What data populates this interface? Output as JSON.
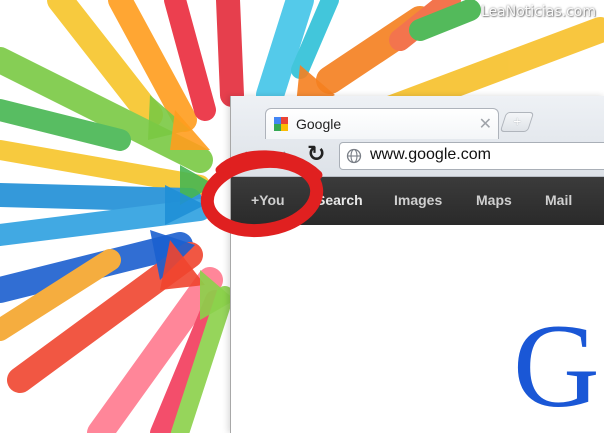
{
  "watermark": "LeaNoticias.com",
  "browser": {
    "tab": {
      "title": "Google",
      "favicon": "google-favicon-icon",
      "close_glyph": "✕"
    },
    "new_tab_glyph": "+",
    "nav": {
      "back_glyph": "←",
      "forward_glyph": "→",
      "reload_glyph": "↻"
    },
    "address": {
      "url": "www.google.com",
      "icon": "globe-icon"
    }
  },
  "google_bar": {
    "items": [
      "+You",
      "Search",
      "Images",
      "Maps",
      "Mail"
    ],
    "active": "Search"
  },
  "logo_letter": "G",
  "colors": {
    "navbar": "#2d2d2d",
    "logo_blue": "#1a57d6",
    "circle_red": "#e02020"
  }
}
